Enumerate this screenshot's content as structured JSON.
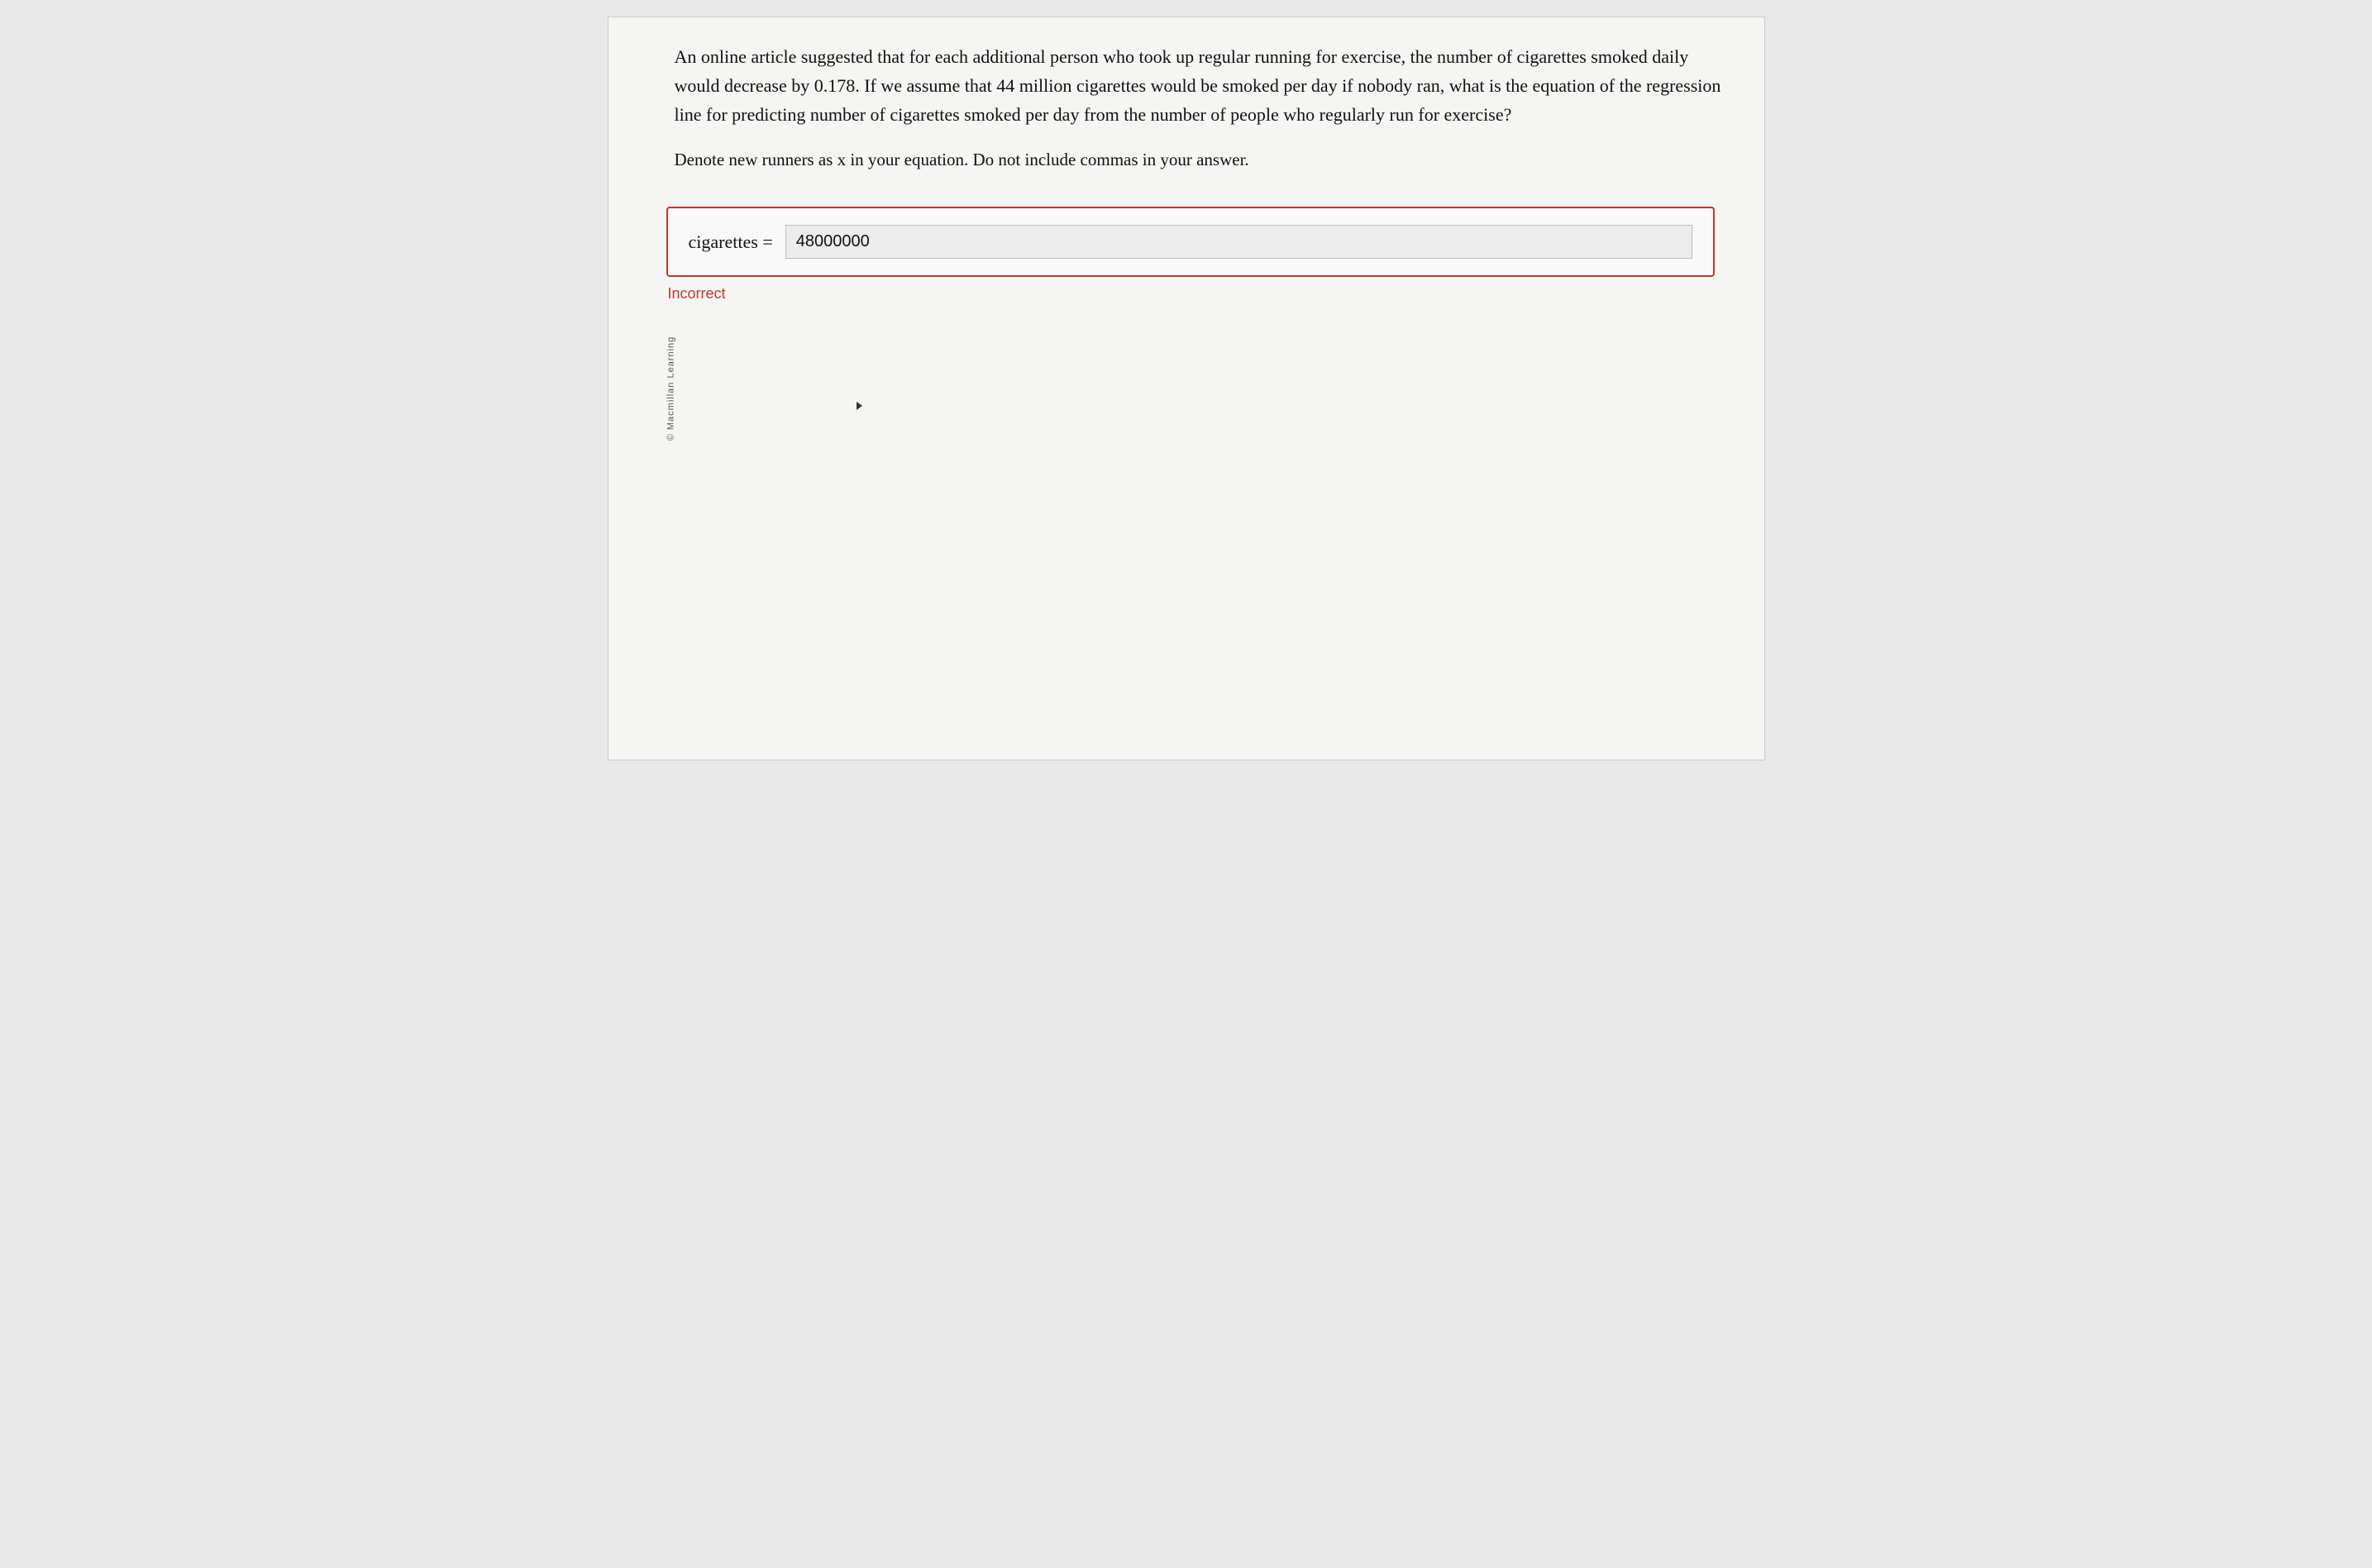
{
  "watermark": {
    "text": "© Macmillan Learning"
  },
  "question": {
    "main_text": "An online article suggested that for each additional person who took up regular running for exercise, the number of cigarettes smoked daily would decrease by 0.178. If we assume that 44 million cigarettes would be smoked per day if nobody ran, what is the equation of the regression line for predicting number of cigarettes smoked per day from the number of people who regularly run for exercise?",
    "instruction_text": "Denote new runners as x in your equation. Do not include commas in your answer.",
    "equation_label": "cigarettes =",
    "input_value": "48000000",
    "incorrect_label": "Incorrect"
  },
  "colors": {
    "incorrect_red": "#c0392b",
    "border_red": "#c0392b",
    "background": "#f5f5f3",
    "input_bg": "#ececec"
  }
}
